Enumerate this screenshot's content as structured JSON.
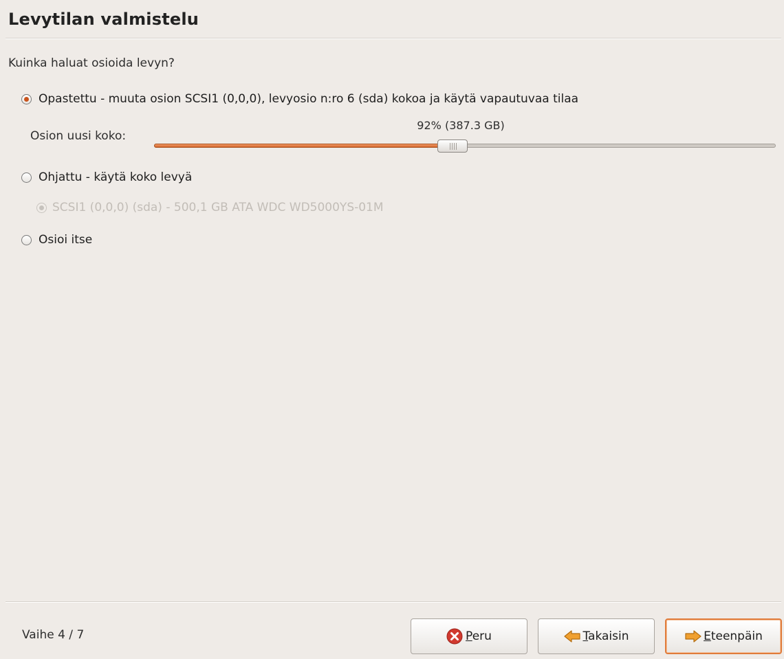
{
  "window": {
    "title": "Levytilan valmistelu",
    "question": "Kuinka haluat osioida levyn?"
  },
  "options": {
    "guided_resize": {
      "label": "Opastettu - muuta osion SCSI1 (0,0,0), levyosio n:ro 6 (sda) kokoa ja käytä vapautuvaa tilaa",
      "checked": true
    },
    "new_size_label": "Osion uusi koko:",
    "new_size_value": "92% (387.3 GB)",
    "slider_fraction": 0.48,
    "guided_whole": {
      "label": "Ohjattu - käytä koko levyä",
      "checked": false
    },
    "disk": {
      "label": "SCSI1 (0,0,0) (sda) - 500,1 GB ATA WDC WD5000YS-01M",
      "checked": true,
      "disabled": true
    },
    "manual": {
      "label": "Osioi itse",
      "checked": false
    }
  },
  "footer": {
    "step": "Vaihe 4 / 7",
    "cancel": {
      "mnemonic": "P",
      "rest": "eru",
      "icon": "cancel-icon"
    },
    "back": {
      "mnemonic": "T",
      "rest": "akaisin",
      "icon": "back-arrow-icon"
    },
    "forward": {
      "mnemonic": "E",
      "rest": "teenpäin",
      "icon": "forward-arrow-icon"
    }
  },
  "colors": {
    "accent": "#d2652d",
    "background": "#efebe7",
    "cancel_icon": "#d13a2f",
    "arrow_icon": "#f0a030"
  }
}
